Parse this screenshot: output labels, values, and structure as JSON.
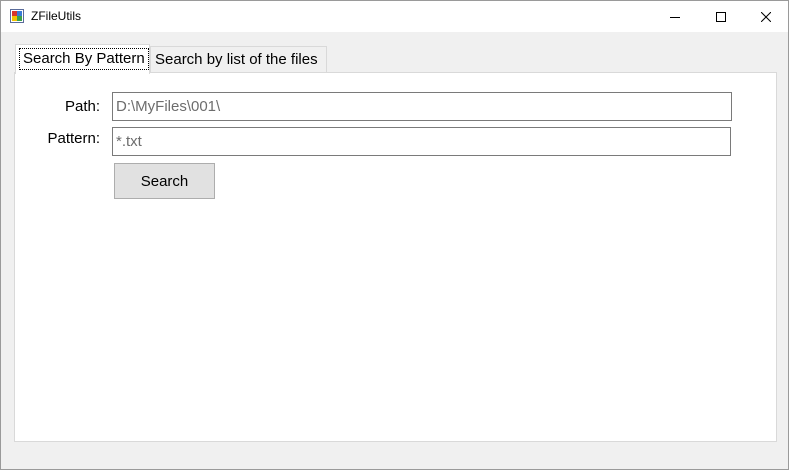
{
  "window": {
    "title": "ZFileUtils",
    "app_icon": "app-icon",
    "controls": {
      "minimize_icon": "minimize-icon",
      "maximize_icon": "maximize-icon",
      "close_icon": "close-icon"
    }
  },
  "tabs": [
    {
      "label": "Search By Pattern",
      "active": true
    },
    {
      "label": "Search by list of the files",
      "active": false
    }
  ],
  "form": {
    "path_label": "Path:",
    "path_value": "D:\\MyFiles\\001\\",
    "pattern_label": "Pattern:",
    "pattern_value": "*.txt",
    "search_button_label": "Search"
  }
}
